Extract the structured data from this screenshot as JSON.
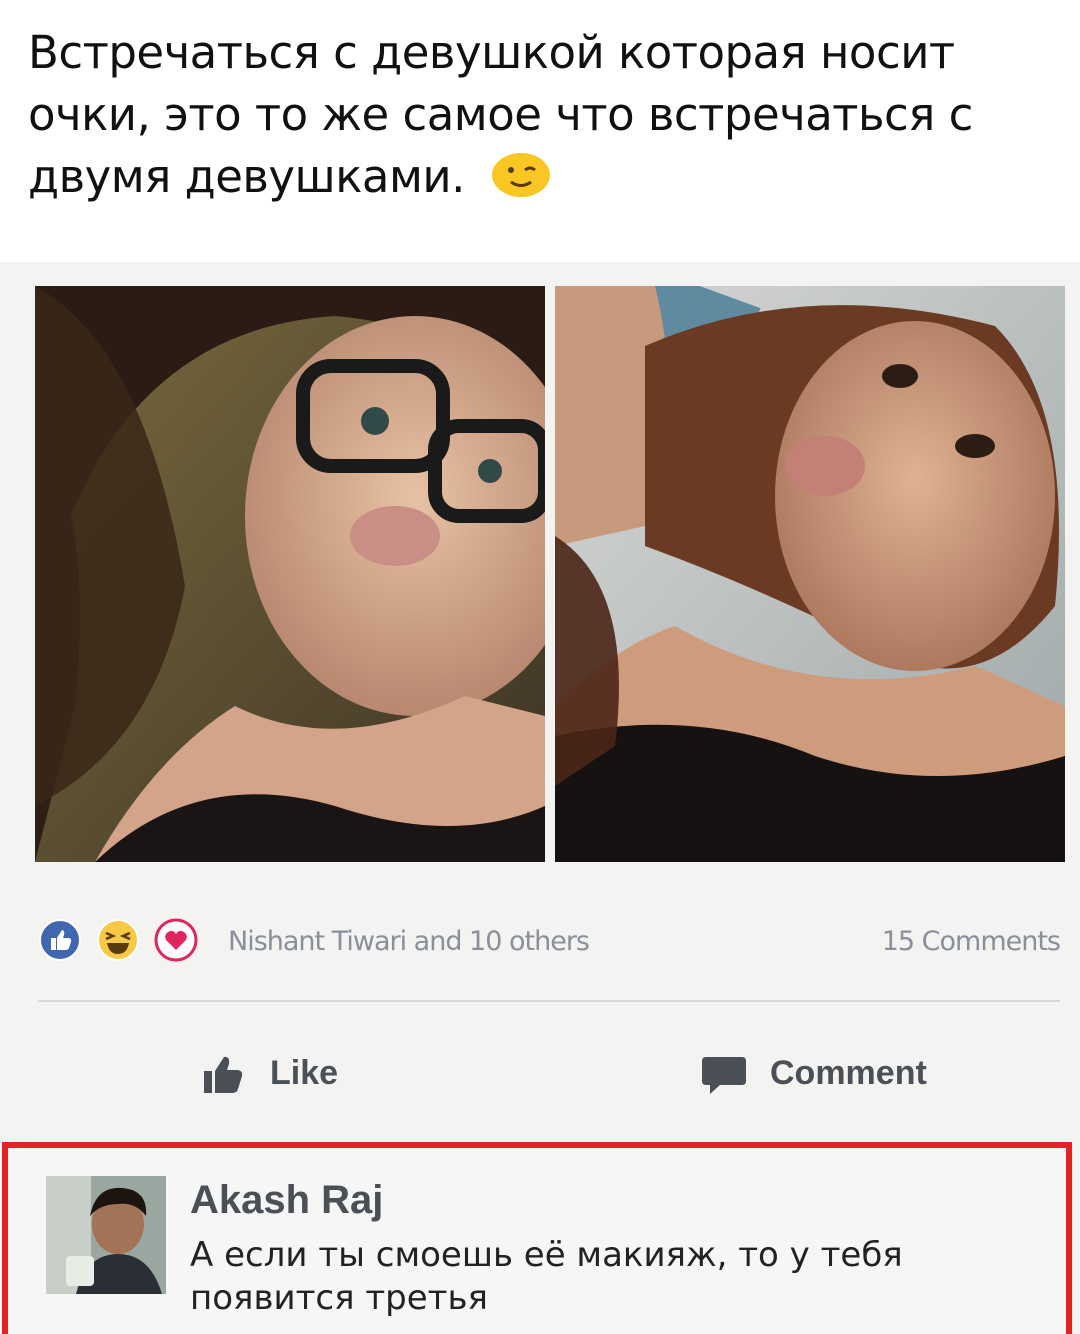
{
  "caption": {
    "text": "Встречаться с девушкой которая носит очки, это то же самое что встречаться с двумя девушками.",
    "emoji": "winking-face-emoji"
  },
  "post": {
    "photos": [
      {
        "subject": "girl-with-glasses"
      },
      {
        "subject": "girl-without-glasses"
      }
    ],
    "reactions": [
      "like",
      "haha",
      "love"
    ],
    "liked_by": "Nishant Tiwari and 10 others",
    "comment_count": "15 Comments",
    "actions": {
      "like_label": "Like",
      "comment_label": "Comment"
    }
  },
  "comment": {
    "author": "Akash Raj",
    "text": "А если ты смоешь её макияж, то у тебя появится третья"
  },
  "colors": {
    "highlight_border": "#e02424",
    "like_blue": "#4267b2",
    "love_red": "#e0245e",
    "haha_yellow": "#f7c944",
    "meta_gray": "#8a8f9a"
  }
}
